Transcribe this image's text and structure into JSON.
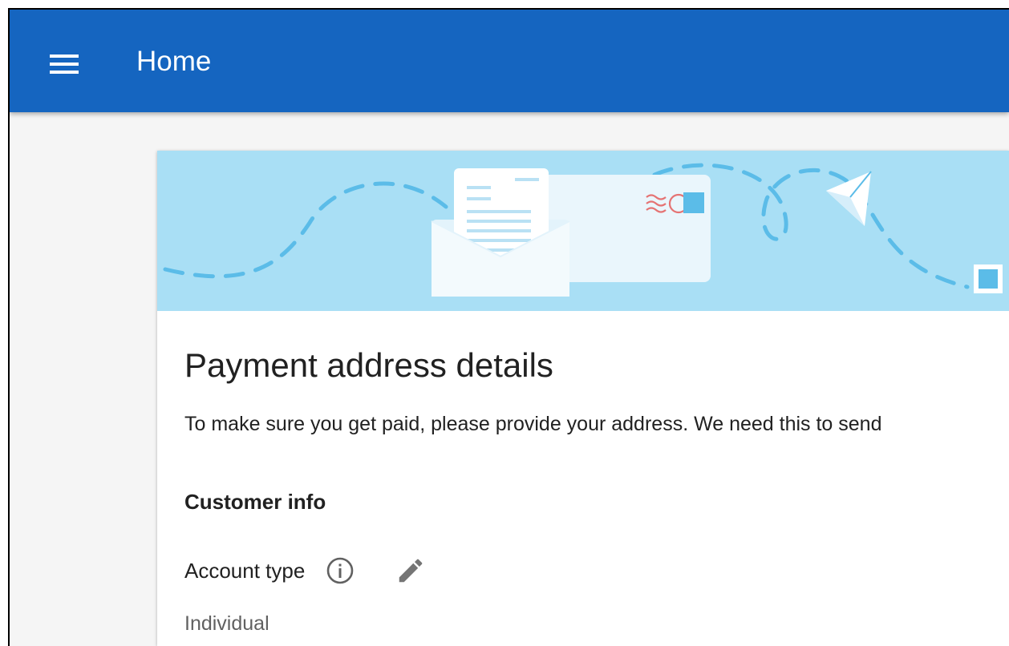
{
  "appbar": {
    "menu_icon": "hamburger-menu-icon",
    "title": "Home"
  },
  "banner": {
    "illustration": "envelope-and-paper-plane-illustration"
  },
  "page": {
    "title": "Payment address details",
    "description": "To make sure you get paid, please provide your address. We need this to send",
    "section_title": "Customer info",
    "account_type": {
      "label": "Account type",
      "info_icon": "info-icon",
      "edit_icon": "pencil-icon",
      "value": "Individual"
    }
  },
  "colors": {
    "appbar": "#1565c0",
    "banner": "#a9dff5",
    "background": "#f5f5f5"
  }
}
